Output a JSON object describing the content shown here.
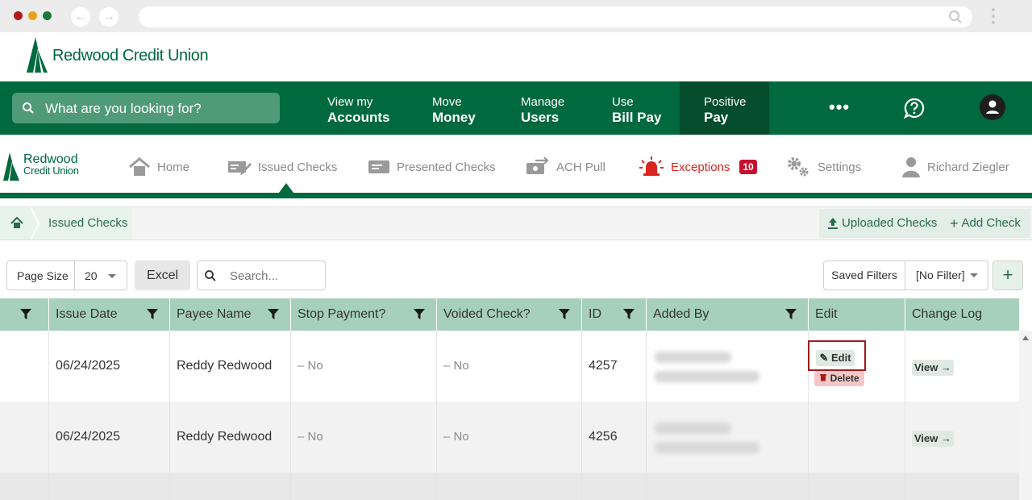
{
  "browser": {
    "dot_colors": [
      "#b31b1b",
      "#e5a41a",
      "#1a7a3c"
    ],
    "url": ""
  },
  "brand": {
    "name": "Redwood Credit Union",
    "small_line1": "Redwood",
    "small_line2": "Credit Union",
    "color": "#00693e"
  },
  "global_search": {
    "placeholder": "What are you looking for?"
  },
  "main_nav": [
    {
      "line1": "View my",
      "line2": "Accounts"
    },
    {
      "line1": "Move",
      "line2": "Money"
    },
    {
      "line1": "Manage",
      "line2": "Users"
    },
    {
      "line1": "Use",
      "line2": "Bill Pay"
    },
    {
      "line1": "Positive",
      "line2": "Pay",
      "active": true
    }
  ],
  "more_menu": "•••",
  "sub_nav": [
    {
      "label": "Home",
      "icon": "home-icon"
    },
    {
      "label": "Issued Checks",
      "icon": "edit-check-icon",
      "active": true
    },
    {
      "label": "Presented Checks",
      "icon": "check-card-icon"
    },
    {
      "label": "ACH Pull",
      "icon": "transfer-icon"
    },
    {
      "label": "Exceptions",
      "icon": "alarm-icon",
      "badge": "10"
    },
    {
      "label": "Settings",
      "icon": "gear-icon"
    },
    {
      "label": "Richard Ziegler",
      "icon": "user-icon"
    }
  ],
  "breadcrumb": {
    "current": "Issued Checks"
  },
  "actions": {
    "uploaded": "Uploaded Checks",
    "add": "Add Check"
  },
  "toolbar": {
    "page_size_label": "Page Size",
    "page_size_value": "20",
    "excel": "Excel",
    "search_placeholder": "Search...",
    "saved_filters": "Saved Filters",
    "filter_value": "[No Filter]",
    "add_symbol": "+"
  },
  "table": {
    "headers": [
      "",
      "Issue Date",
      "Payee Name",
      "Stop Payment?",
      "Voided Check?",
      "ID",
      "Added By",
      "Edit",
      "Change Log"
    ],
    "rows": [
      {
        "date": "06/24/2025",
        "payee": "Reddy Redwood",
        "stop": "–  No",
        "voided": "–  No",
        "id": "4257",
        "edit": "Edit",
        "delete": "Delete",
        "log": "View →"
      },
      {
        "date": "06/24/2025",
        "payee": "Reddy Redwood",
        "stop": "–  No",
        "voided": "–  No",
        "id": "4256",
        "log": "View →"
      }
    ]
  },
  "colors": {
    "nav_green": "#00693e",
    "nav_active": "#034c2c",
    "header_green": "#a6d0bb",
    "alert_red": "#d9251d",
    "highlight": "#a11b1b"
  }
}
